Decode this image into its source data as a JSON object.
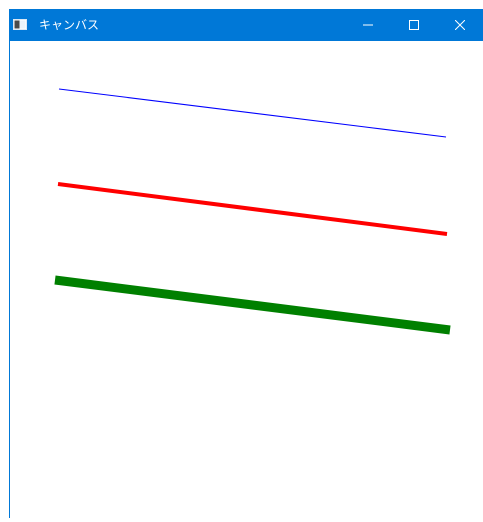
{
  "window": {
    "title": "キャンバス",
    "titlebar_color": "#0078d7",
    "border_color": "#0078d7",
    "app_icon": "window-app-icon",
    "controls": [
      {
        "name": "minimize-button",
        "icon": "minimize-icon"
      },
      {
        "name": "maximize-button",
        "icon": "maximize-icon"
      },
      {
        "name": "close-button",
        "icon": "close-icon"
      }
    ]
  },
  "canvas": {
    "background": "#ffffff",
    "lines": [
      {
        "name": "blue-line",
        "color": "#0000ff"
      },
      {
        "name": "red-line",
        "color": "#ff0000"
      },
      {
        "name": "green-line",
        "color": "#008000"
      }
    ]
  }
}
